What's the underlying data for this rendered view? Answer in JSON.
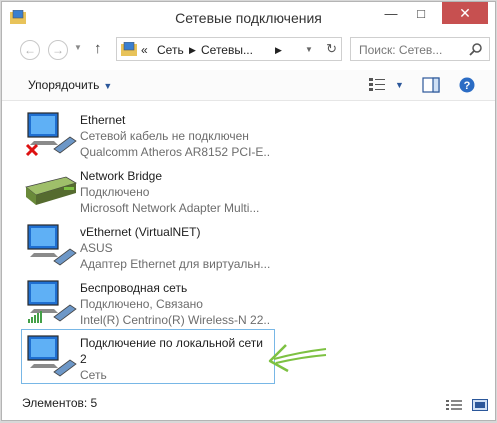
{
  "window": {
    "title": "Сетевые подключения"
  },
  "navigation": {
    "address_crumbs": [
      "«",
      "Сеть",
      "Сетевы..."
    ],
    "search_placeholder": "Поиск: Сетев..."
  },
  "toolbar": {
    "organize_label": "Упорядочить"
  },
  "connections": [
    {
      "name": "Ethernet",
      "status": "Сетевой кабель не подключен",
      "adapter": "Qualcomm Atheros AR8152 PCI-E...",
      "icon": "ethernet-disconnected-icon"
    },
    {
      "name": "Network Bridge",
      "status": "Подключено",
      "adapter": "Microsoft Network Adapter Multi...",
      "icon": "network-bridge-icon"
    },
    {
      "name": "vEthernet (VirtualNET)",
      "status": "ASUS",
      "adapter": "Адаптер Ethernet для виртуальн...",
      "icon": "vethernet-icon"
    },
    {
      "name": "Беспроводная сеть",
      "status": "Подключено, Связано",
      "adapter": "Intel(R) Centrino(R) Wireless-N 22...",
      "icon": "wireless-icon"
    },
    {
      "name": "Подключение по локальной сети",
      "name_line2": "2",
      "status": "Сеть",
      "icon": "lan-connection-icon",
      "selected": true
    }
  ],
  "statusbar": {
    "items_count": "Элементов: 5"
  },
  "colors": {
    "accent": "#2b579a",
    "close_button": "#c75050",
    "selection_border": "#78b7e6",
    "annotation_arrow": "#7dc142"
  }
}
